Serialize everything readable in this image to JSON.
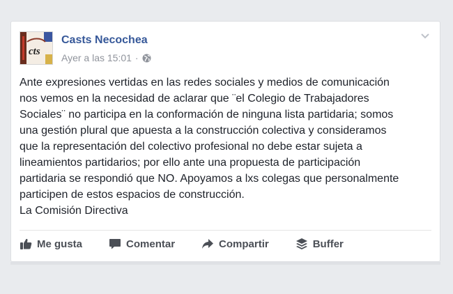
{
  "post": {
    "author": "Casts Necochea",
    "timestamp": "Ayer a las 15:01",
    "separator": "·",
    "privacy_icon": "globe-icon",
    "avatar_text": "cts",
    "body": "Ante expresiones vertidas en las redes sociales y medios de comunicación\nnos vemos en la necesidad de aclarar que ¨el Colegio de Trabajadores\nSociales¨ no participa en la conformación de ninguna lista partidaria; somos\nuna gestión plural que apuesta a la construcción colectiva y consideramos\nque la representación del colectivo profesional no debe estar sujeta a\nlineamientos partidarios; por ello ante una propuesta de participación\npartidaria se respondió que NO. Apoyamos a lxs colegas que personalmente\nparticipen de estos espacios de construcción.",
    "signature": "La Comisión Directiva"
  },
  "actions": {
    "like": "Me gusta",
    "comment": "Comentar",
    "share": "Compartir",
    "buffer": "Buffer"
  },
  "colors": {
    "author": "#365899",
    "meta": "#90949c",
    "text": "#1d2129",
    "action": "#4b4f56",
    "background": "#e9ebee"
  }
}
